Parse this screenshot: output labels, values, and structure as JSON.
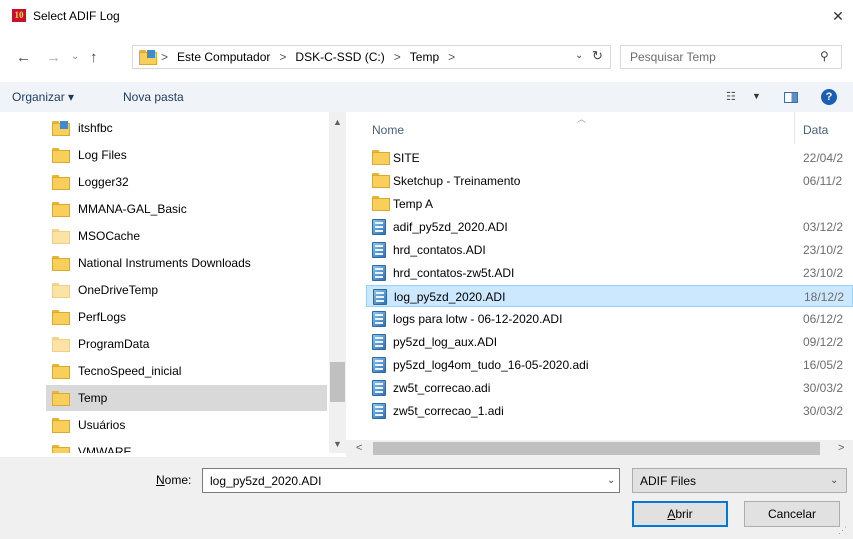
{
  "window": {
    "title": "Select ADIF Log",
    "app_icon_text": "10",
    "close_symbol": "✕"
  },
  "address": {
    "back": "←",
    "forward": "→",
    "recent": "⌄",
    "up": "↑",
    "separator": ">",
    "crumbs": [
      "Este Computador",
      "DSK-C-SSD (C:)",
      "Temp"
    ],
    "dropdown": "⌄",
    "refresh": "↻"
  },
  "search": {
    "placeholder": "Pesquisar Temp",
    "icon": "⚲"
  },
  "toolbar": {
    "organize_label": "Organizar ▾",
    "new_folder_label": "Nova pasta",
    "view_icon": "☷",
    "view_dropdown": "▼",
    "help_label": "?"
  },
  "nav_pane": {
    "items": [
      {
        "label": "itshfbc",
        "style": "shortcut"
      },
      {
        "label": "Log Files",
        "style": "normal"
      },
      {
        "label": "Logger32",
        "style": "normal"
      },
      {
        "label": "MMANA-GAL_Basic",
        "style": "normal"
      },
      {
        "label": "MSOCache",
        "style": "faded"
      },
      {
        "label": "National Instruments Downloads",
        "style": "normal"
      },
      {
        "label": "OneDriveTemp",
        "style": "faded"
      },
      {
        "label": "PerfLogs",
        "style": "normal"
      },
      {
        "label": "ProgramData",
        "style": "faded"
      },
      {
        "label": "TecnoSpeed_inicial",
        "style": "normal"
      },
      {
        "label": "Temp",
        "style": "normal",
        "selected": true
      },
      {
        "label": "Usuários",
        "style": "normal"
      },
      {
        "label": "VMWARE",
        "style": "normal"
      }
    ],
    "scroll_up": "▲",
    "scroll_down": "▼"
  },
  "file_pane": {
    "columns": {
      "name": "Nome",
      "date": "Data",
      "sort_arrow": "︿"
    },
    "files": [
      {
        "name": "SITE",
        "date": "22/04/2",
        "type": "folder"
      },
      {
        "name": "Sketchup - Treinamento",
        "date": "06/11/2",
        "type": "folder"
      },
      {
        "name": "Temp A",
        "date": "",
        "type": "folder"
      },
      {
        "name": "adif_py5zd_2020.ADI",
        "date": "03/12/2",
        "type": "file"
      },
      {
        "name": "hrd_contatos.ADI",
        "date": "23/10/2",
        "type": "file"
      },
      {
        "name": "hrd_contatos-zw5t.ADI",
        "date": "23/10/2",
        "type": "file"
      },
      {
        "name": "log_py5zd_2020.ADI",
        "date": "18/12/2",
        "type": "file",
        "selected": true
      },
      {
        "name": "logs para lotw - 06-12-2020.ADI",
        "date": "06/12/2",
        "type": "file"
      },
      {
        "name": "py5zd_log_aux.ADI",
        "date": "09/12/2",
        "type": "file"
      },
      {
        "name": "py5zd_log4om_tudo_16-05-2020.adi",
        "date": "16/05/2",
        "type": "file"
      },
      {
        "name": "zw5t_correcao.adi",
        "date": "30/03/2",
        "type": "file"
      },
      {
        "name": "zw5t_correcao_1.adi",
        "date": "30/03/2",
        "type": "file"
      }
    ],
    "scroll_left": "<",
    "scroll_right": ">"
  },
  "bottom": {
    "name_label_underlined": "N",
    "name_label_rest": "ome:",
    "filename_value": "log_py5zd_2020.ADI",
    "filename_dropdown": "⌄",
    "file_type": "ADIF Files",
    "file_type_dropdown": "⌄",
    "open_underlined": "A",
    "open_rest": "brir",
    "cancel_label": "Cancelar",
    "grip": "⋰"
  },
  "colors": {
    "selection_bg": "#cce8ff",
    "selection_border": "#99d1ff",
    "nav_selected_bg": "#d9d9d9",
    "accent_blue": "#0078d7",
    "folder_yellow": "#f8cf5b"
  }
}
